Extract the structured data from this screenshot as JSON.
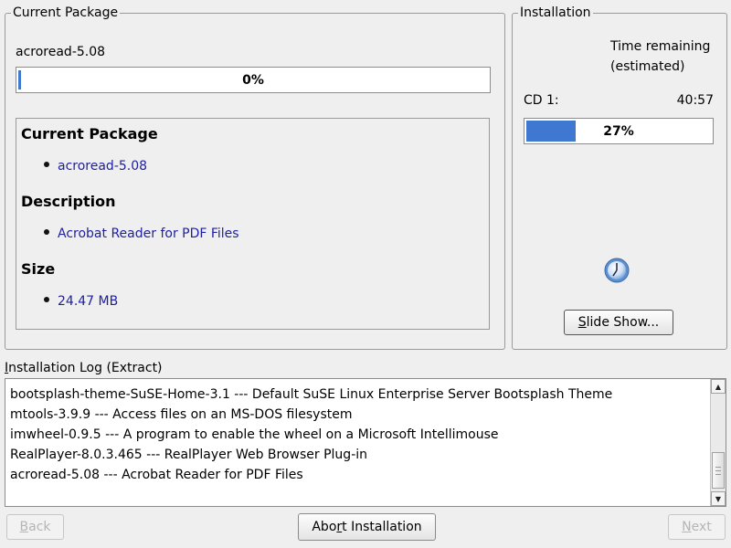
{
  "current_package_group": {
    "title": "Current Package",
    "package_name": "acroread-5.08",
    "progress_text": "0%",
    "progress_fraction": 0.0,
    "info": {
      "heading_package": "Current Package",
      "package_value": "acroread-5.08",
      "heading_description": "Description",
      "description_value": "Acrobat Reader for PDF Files",
      "heading_size": "Size",
      "size_value": "24.47 MB"
    }
  },
  "installation_group": {
    "title": "Installation",
    "time_remaining_line1": "Time remaining",
    "time_remaining_line2": "(estimated)",
    "cd_label": "CD 1:",
    "cd_time": "40:57",
    "progress_text": "27%",
    "progress_fraction": 0.27,
    "clock_icon": "clock-icon",
    "slideshow_prefix": "",
    "slideshow_mnemonic": "S",
    "slideshow_rest": "lide Show..."
  },
  "log": {
    "label_mnemonic": "I",
    "label_rest": "nstallation Log (Extract)",
    "lines": [
      "bootsplash-theme-SuSE-Home-3.1 --- Default SuSE Linux Enterprise Server Bootsplash Theme",
      "mtools-3.9.9 --- Access files on an MS-DOS filesystem",
      "imwheel-0.9.5 --- A program to enable the wheel on a Microsoft Intellimouse",
      "RealPlayer-8.0.3.465 --- RealPlayer Web Browser Plug-in",
      "acroread-5.08 --- Acrobat Reader for PDF Files"
    ]
  },
  "buttons": {
    "back_mnemonic": "B",
    "back_rest": "ack",
    "abort_prefix": "Abo",
    "abort_mnemonic": "r",
    "abort_rest": "t Installation",
    "next_mnemonic": "N",
    "next_rest": "ext"
  },
  "colors": {
    "progress_fill": "#3f78d0",
    "link_text": "#2020a0",
    "background": "#efefef"
  }
}
